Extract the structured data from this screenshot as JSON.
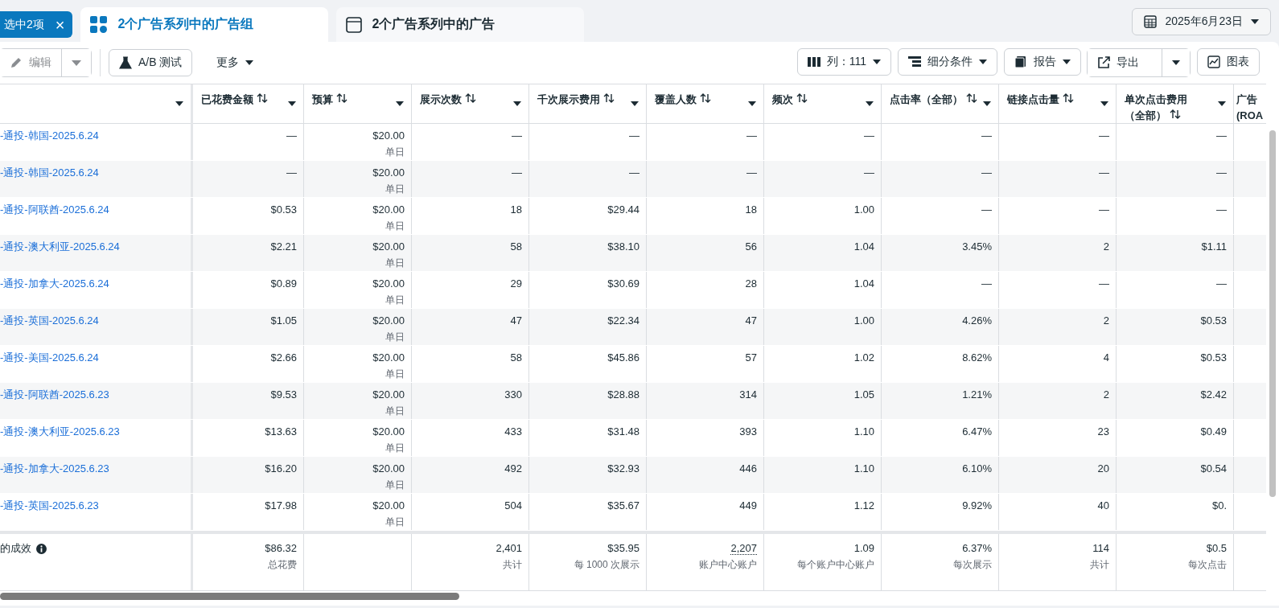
{
  "selection_chip": {
    "label": "选中2项",
    "close": "×"
  },
  "tabs": [
    {
      "label": "2个广告系列中的广告组",
      "selected": true
    },
    {
      "label": "2个广告系列中的广告",
      "selected": false
    }
  ],
  "date_button": {
    "label": "2025年6月23日"
  },
  "toolbar": {
    "edit_button": {
      "label": "编辑",
      "disabled": true
    },
    "ab_test_button": {
      "label": "A/B 测试"
    },
    "more_menu": {
      "label": "更多"
    },
    "right_buttons": [
      {
        "kind": "columns",
        "label": "列：111"
      },
      {
        "kind": "breakdown",
        "label": "细分条件"
      },
      {
        "kind": "reports",
        "label": "报告"
      },
      {
        "kind": "export",
        "label": "导出"
      },
      {
        "kind": "charts",
        "label": "图表"
      }
    ]
  },
  "table": {
    "columns": [
      {
        "sortable": false
      },
      {
        "label": "已花费金额",
        "sortable": true
      },
      {
        "label": "预算",
        "sortable": true
      },
      {
        "label": "展示次数",
        "sortable": true
      },
      {
        "label": "千次展示费用",
        "sortable": true
      },
      {
        "label": "覆盖人数",
        "sortable": true
      },
      {
        "label": "频次",
        "sortable": true
      },
      {
        "label": "点击率（全部）",
        "sortable": true
      },
      {
        "label": "链接点击量",
        "sortable": true
      },
      {
        "lines": [
          "单次点击费用",
          "（全部）"
        ],
        "sortable": true
      },
      {
        "lines": [
          "广告",
          "(ROA"
        ],
        "sortable": false
      }
    ],
    "rows": [
      {
        "name": "-通投-韩国-2025.6.24",
        "cells": [
          "—",
          {
            "value": "$20.00",
            "note": "单日"
          },
          "—",
          "—",
          "—",
          "—",
          "—",
          "—",
          "—"
        ]
      },
      {
        "name": "-通投-韩国-2025.6.24",
        "cells": [
          "—",
          {
            "value": "$20.00",
            "note": "单日"
          },
          "—",
          "—",
          "—",
          "—",
          "—",
          "—",
          "—"
        ]
      },
      {
        "name": "-通投-阿联酋-2025.6.24",
        "cells": [
          "$0.53",
          {
            "value": "$20.00",
            "note": "单日"
          },
          "18",
          "$29.44",
          "18",
          "1.00",
          "—",
          "—",
          "—"
        ]
      },
      {
        "name": "-通投-澳大利亚-2025.6.24",
        "cells": [
          "$2.21",
          {
            "value": "$20.00",
            "note": "单日"
          },
          "58",
          "$38.10",
          "56",
          "1.04",
          "3.45%",
          "2",
          "$1.11"
        ]
      },
      {
        "name": "-通投-加拿大-2025.6.24",
        "cells": [
          "$0.89",
          {
            "value": "$20.00",
            "note": "单日"
          },
          "29",
          "$30.69",
          "28",
          "1.04",
          "—",
          "—",
          "—"
        ]
      },
      {
        "name": "-通投-英国-2025.6.24",
        "cells": [
          "$1.05",
          {
            "value": "$20.00",
            "note": "单日"
          },
          "47",
          "$22.34",
          "47",
          "1.00",
          "4.26%",
          "2",
          "$0.53"
        ]
      },
      {
        "name": "-通投-美国-2025.6.24",
        "cells": [
          "$2.66",
          {
            "value": "$20.00",
            "note": "单日"
          },
          "58",
          "$45.86",
          "57",
          "1.02",
          "8.62%",
          "4",
          "$0.53"
        ]
      },
      {
        "name": "-通投-阿联酋-2025.6.23",
        "cells": [
          "$9.53",
          {
            "value": "$20.00",
            "note": "单日"
          },
          "330",
          "$28.88",
          "314",
          "1.05",
          "1.21%",
          "2",
          "$2.42"
        ]
      },
      {
        "name": "-通投-澳大利亚-2025.6.23",
        "cells": [
          "$13.63",
          {
            "value": "$20.00",
            "note": "单日"
          },
          "433",
          "$31.48",
          "393",
          "1.10",
          "6.47%",
          "23",
          "$0.49"
        ]
      },
      {
        "name": "-通投-加拿大-2025.6.23",
        "cells": [
          "$16.20",
          {
            "value": "$20.00",
            "note": "单日"
          },
          "492",
          "$32.93",
          "446",
          "1.10",
          "6.10%",
          "20",
          "$0.54"
        ]
      },
      {
        "name": "-通投-英国-2025.6.23",
        "cells": [
          "$17.98",
          {
            "value": "$20.00",
            "note": "单日"
          },
          "504",
          "$35.67",
          "449",
          "1.12",
          "9.92%",
          "40",
          "$0."
        ]
      }
    ],
    "summary": {
      "label": "的成效",
      "cells": [
        {
          "value": "$86.32",
          "note": "总花费"
        },
        {},
        {
          "value": "2,401",
          "note": "共计"
        },
        {
          "value": "$35.95",
          "note": "每 1000 次展示"
        },
        {
          "value": "2,207",
          "note": "账户中心账户",
          "dotted": true
        },
        {
          "value": "1.09",
          "note": "每个账户中心账户"
        },
        {
          "value": "6.37%",
          "note": "每次展示"
        },
        {
          "value": "114",
          "note": "共计"
        },
        {
          "value": "$0.5",
          "note": "每次点击"
        }
      ]
    }
  }
}
